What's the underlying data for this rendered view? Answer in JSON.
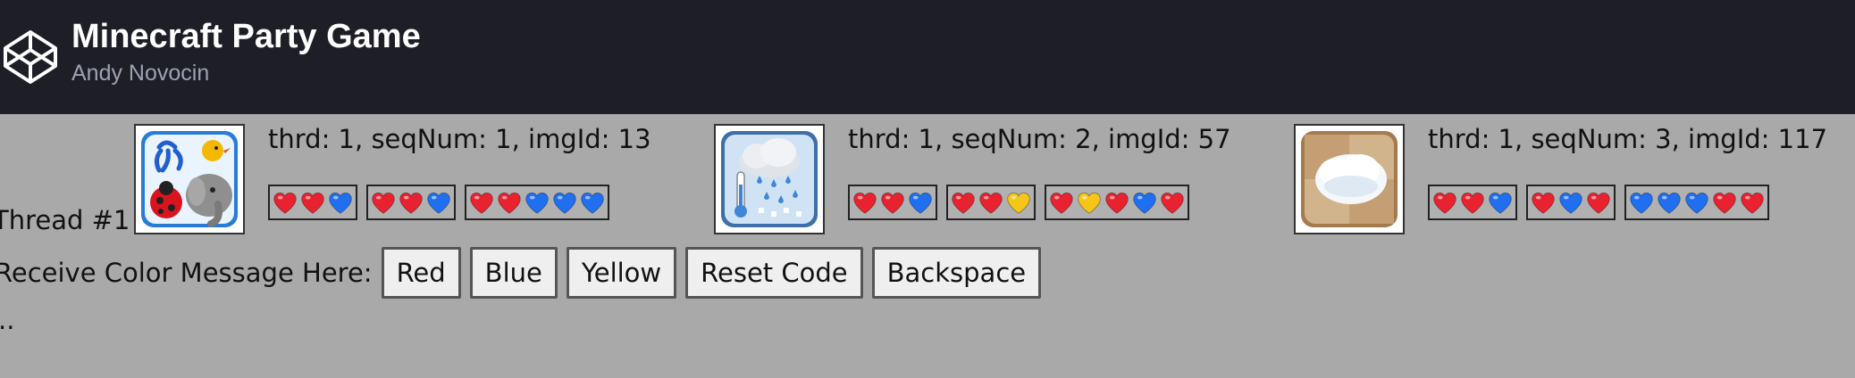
{
  "header": {
    "title": "Minecraft Party Game",
    "author": "Andy Novocin"
  },
  "thread": {
    "label": "Thread #1"
  },
  "colors": {
    "red": "#e8222f",
    "blue": "#1f6ff0",
    "yellow": "#f5c518",
    "header_bg": "#1e1f26",
    "page_bg": "#a9a9a9"
  },
  "cards": [
    {
      "meta": "thrd: 1, seqNum: 1, imgId: 13",
      "image": "animals-icon",
      "codes": [
        [
          "red",
          "red",
          "blue"
        ],
        [
          "red",
          "red",
          "blue"
        ],
        [
          "red",
          "red",
          "blue",
          "blue",
          "blue"
        ]
      ]
    },
    {
      "meta": "thrd: 1, seqNum: 2, imgId: 57",
      "image": "weather-icon",
      "codes": [
        [
          "red",
          "red",
          "blue"
        ],
        [
          "red",
          "red",
          "yellow"
        ],
        [
          "red",
          "yellow",
          "red",
          "blue",
          "red"
        ]
      ]
    },
    {
      "meta": "thrd: 1, seqNum: 3, imgId: 117",
      "image": "cloud-icon",
      "codes": [
        [
          "red",
          "red",
          "blue"
        ],
        [
          "red",
          "blue",
          "red"
        ],
        [
          "blue",
          "blue",
          "blue",
          "red",
          "red"
        ]
      ]
    }
  ],
  "receive": {
    "label": "Receive Color Message Here:",
    "buttons": {
      "red": "Red",
      "blue": "Blue",
      "yellow": "Yellow",
      "reset": "Reset Code",
      "backspace": "Backspace"
    }
  },
  "status": {
    "text": ".."
  }
}
